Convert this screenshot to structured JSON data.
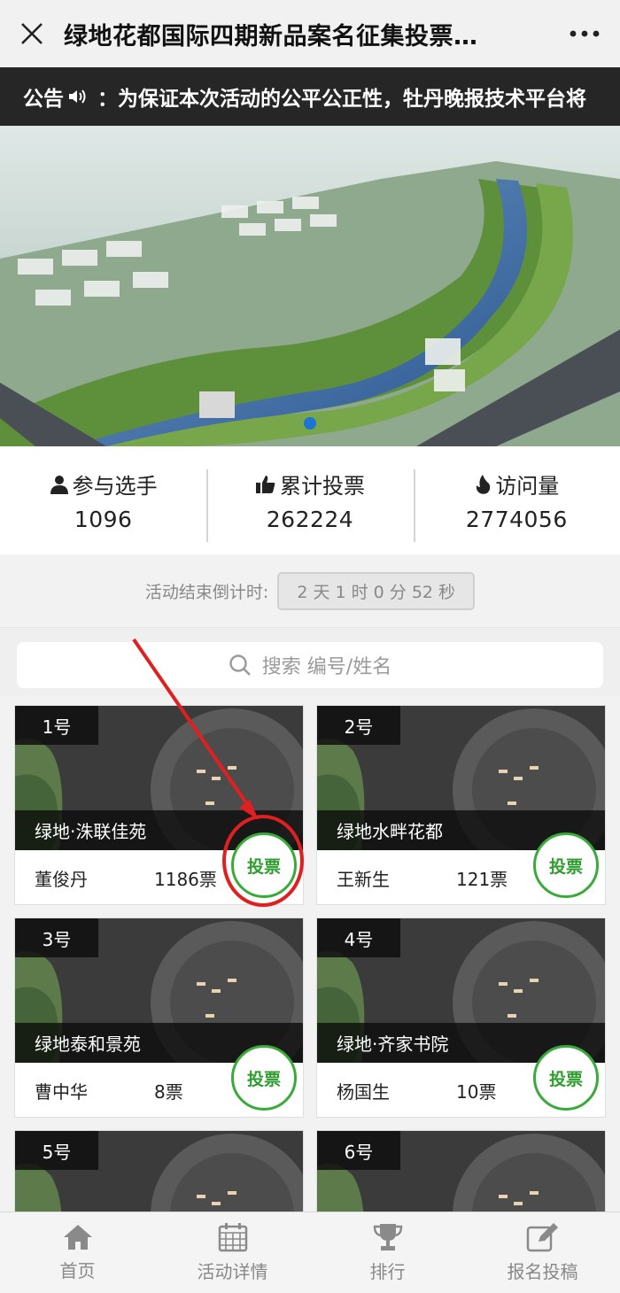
{
  "titlebar": {
    "title": "绿地花都国际四期新品案名征集投票…",
    "close_icon": "close-icon",
    "more_icon": "more-dots-icon"
  },
  "notice": {
    "label": "公告",
    "text": "：为保证本次活动的公平公正性，牡丹晚报技术平台将"
  },
  "stats": [
    {
      "label": "参与选手",
      "value": "1096",
      "icon": "user-icon"
    },
    {
      "label": "累计投票",
      "value": "262224",
      "icon": "thumbs-up-icon"
    },
    {
      "label": "访问量",
      "value": "2774056",
      "icon": "fire-icon"
    }
  ],
  "countdown": {
    "label": "活动结束倒计时:",
    "value": "2 天 1 时 0 分 52 秒"
  },
  "search": {
    "placeholder": "搜索 编号/姓名"
  },
  "vote_label": "投票",
  "candidates": [
    {
      "no": "1号",
      "title": "绿地·洙联佳苑",
      "person": "董俊丹",
      "votes": "1186票"
    },
    {
      "no": "2号",
      "title": "绿地水畔花都",
      "person": "王新生",
      "votes": "121票"
    },
    {
      "no": "3号",
      "title": "绿地泰和景苑",
      "person": "曹中华",
      "votes": "8票"
    },
    {
      "no": "4号",
      "title": "绿地·齐家书院",
      "person": "杨国生",
      "votes": "10票"
    },
    {
      "no": "5号"
    },
    {
      "no": "6号"
    }
  ],
  "nav": [
    {
      "label": "首页",
      "icon": "home-icon"
    },
    {
      "label": "活动详情",
      "icon": "calendar-icon"
    },
    {
      "label": "排行",
      "icon": "trophy-icon"
    },
    {
      "label": "报名投稿",
      "icon": "edit-icon"
    }
  ],
  "colors": {
    "accent_green": "#3aab3a",
    "annotation_red": "#e02020",
    "pager_blue": "#1e73d6"
  }
}
